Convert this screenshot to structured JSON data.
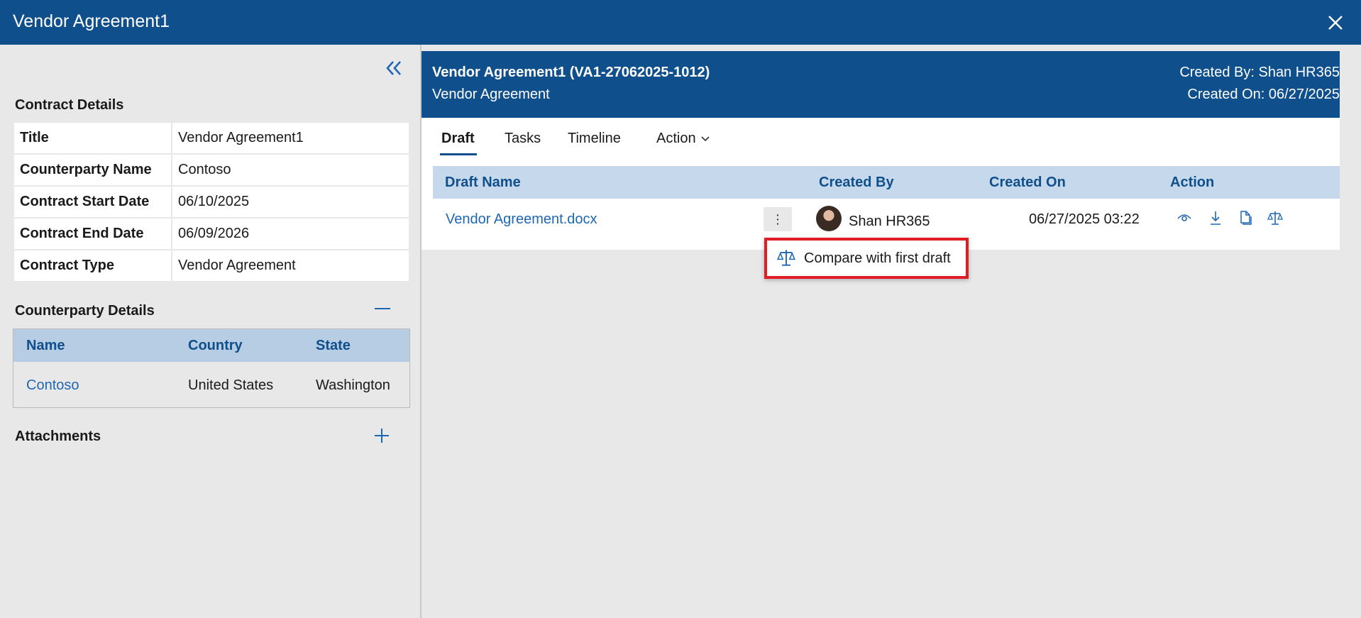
{
  "window": {
    "title": "Vendor Agreement1"
  },
  "contract_details": {
    "heading": "Contract Details",
    "rows": [
      {
        "label": "Title",
        "value": "Vendor Agreement1"
      },
      {
        "label": "Counterparty Name",
        "value": "Contoso"
      },
      {
        "label": "Contract Start Date",
        "value": "06/10/2025"
      },
      {
        "label": "Contract End Date",
        "value": "06/09/2026"
      },
      {
        "label": "Contract Type",
        "value": "Vendor Agreement"
      }
    ]
  },
  "counterparty": {
    "heading": "Counterparty Details",
    "columns": [
      "Name",
      "Country",
      "State"
    ],
    "row": {
      "name": "Contoso",
      "country": "United States",
      "state": "Washington"
    }
  },
  "attachments": {
    "heading": "Attachments"
  },
  "header": {
    "title": "Vendor Agreement1 (VA1-27062025-1012)",
    "subtitle": "Vendor Agreement",
    "created_by": "Created By: Shan HR365",
    "created_on": "Created On: 06/27/2025"
  },
  "tabs": [
    {
      "label": "Draft"
    },
    {
      "label": "Tasks"
    },
    {
      "label": "Timeline"
    },
    {
      "label": "Action"
    }
  ],
  "draft_grid": {
    "columns": [
      "Draft Name",
      "Created By",
      "Created On",
      "Action"
    ],
    "row": {
      "name": "Vendor Agreement.docx",
      "more": "⋮",
      "created_by": "Shan HR365",
      "created_on": "06/27/2025 03:22"
    },
    "action_icons": [
      "eye-icon",
      "download-icon",
      "copy-icon",
      "scale-icon"
    ]
  },
  "popup_menu": {
    "label": "Compare with first draft",
    "icon": "scale-icon"
  },
  "colors": {
    "brand": "#0f4f8c",
    "link": "#1f67b3",
    "highlight": "#e01d25"
  }
}
